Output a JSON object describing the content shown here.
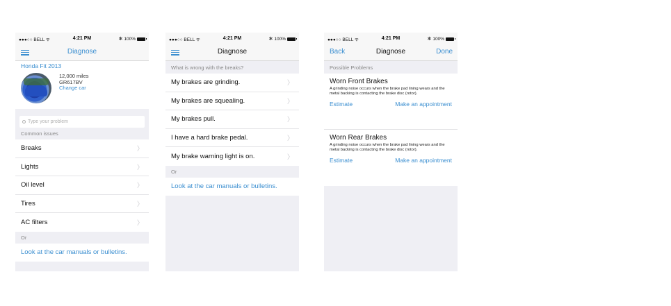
{
  "status": {
    "carrier": "●●●○○ BELL ᯤ",
    "time": "4:21 PM",
    "battery": "100%"
  },
  "screen1": {
    "title": "Diagnose",
    "car": {
      "name": "Honda Fit 2013",
      "miles": "12,000 miles",
      "plate": "GR617BV",
      "change": "Change car"
    },
    "search_placeholder": "Type your problem",
    "section": "Common issues",
    "items": [
      {
        "label": "Breaks"
      },
      {
        "label": "Lights"
      },
      {
        "label": "Oil level"
      },
      {
        "label": "Tires"
      },
      {
        "label": "AC filters"
      }
    ],
    "or": "Or",
    "link": "Look at the car manuals or bulletins."
  },
  "screen2": {
    "title": "Diagnose",
    "question": "What is wrong with the breaks?",
    "items": [
      {
        "label": "My brakes are grinding."
      },
      {
        "label": "My brakes are squealing."
      },
      {
        "label": "My brakes pull."
      },
      {
        "label": "I have a hard brake pedal."
      },
      {
        "label": "My brake warning light is on."
      }
    ],
    "or": "Or",
    "link": "Look at the car manuals or bulletins."
  },
  "screen3": {
    "back": "Back",
    "title": "Diagnose",
    "done": "Done",
    "section": "Possible Problems",
    "problems": [
      {
        "title": "Worn Front Brakes",
        "description": "A grinding noise occurs when the brake pad lining wears and the metal backing is contacting the brake disc (rotor).",
        "estimate": "Estimate",
        "appointment": "Make an appointment"
      },
      {
        "title": "Worn Rear Brakes",
        "description": "A grinding noise occurs when the brake pad lining wears and the metal backing is contacting the brake disc (rotor).",
        "estimate": "Estimate",
        "appointment": "Make an appointment"
      }
    ]
  },
  "colors": {
    "accent": "#3a8ed0",
    "background": "#efeff4"
  }
}
